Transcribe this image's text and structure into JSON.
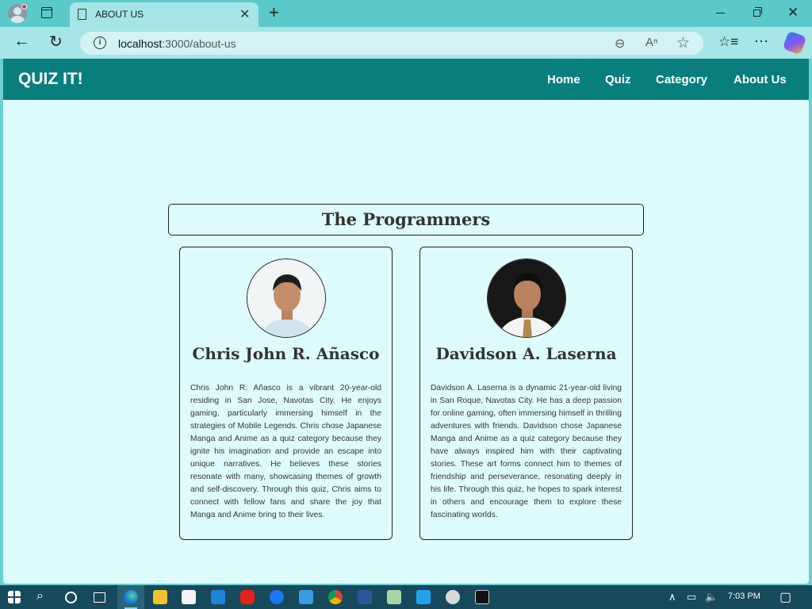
{
  "browser": {
    "tab_title": "ABOUT US",
    "url_host": "localhost",
    "url_rest": ":3000/about-us"
  },
  "site": {
    "brand": "QUIZ IT!",
    "nav": [
      "Home",
      "Quiz",
      "Category",
      "About Us"
    ]
  },
  "section_title": "The Programmers",
  "programmers": [
    {
      "name": "Chris John R. Añasco",
      "bio": "Chris John R. Añasco is a vibrant 20-year-old residing in San Jose, Navotas City. He enjoys gaming, particularly immersing himself in the strategies of Mobile Legends. Chris chose Japanese Manga and Anime as a quiz category because they ignite his imagination and provide an escape into unique narratives. He believes these stories resonate with many, showcasing themes of growth and self-discovery. Through this quiz, Chris aims to connect with fellow fans and share the joy that Manga and Anime bring to their lives."
    },
    {
      "name": "Davidson A. Laserna",
      "bio": "Davidson A. Laserna is a dynamic 21-year-old living in San Roque, Navotas City. He has a deep passion for online gaming, often immersing himself in thrilling adventures with friends. Davidson chose Japanese Manga and Anime as a quiz category because they have always inspired him with their captivating stories. These art forms connect him to themes of friendship and perseverance, resonating deeply in his life. Through this quiz, he hopes to spark interest in others and encourage them to explore these fascinating worlds."
    }
  ],
  "taskbar": {
    "clock": "7:03 PM"
  },
  "colors": {
    "header": "#087f7d",
    "page_bg": "#dffcfc",
    "browser_frame": "#5ccaca"
  }
}
